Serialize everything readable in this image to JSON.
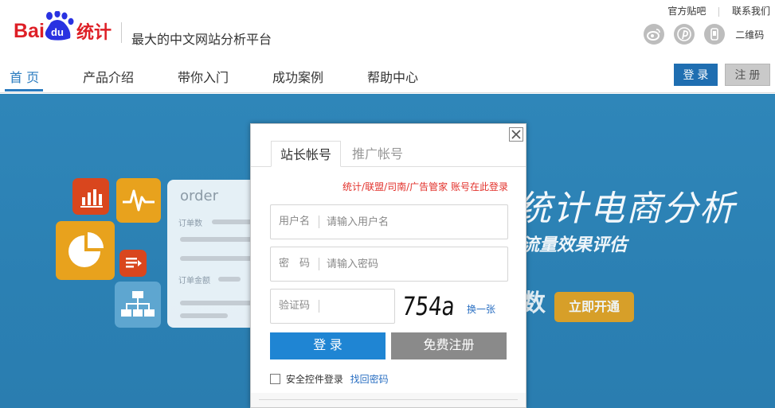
{
  "header": {
    "logo_text_bai": "Bai",
    "logo_text_du": "du",
    "logo_text_tongji": "统计",
    "tagline": "最大的中文网站分析平台",
    "top_links": [
      "官方贴吧",
      "联系我们"
    ],
    "qrcode_label": "二维码",
    "social_icons": [
      "weibo-icon",
      "pinterest-icon",
      "wechat-icon"
    ]
  },
  "nav": {
    "items": [
      "首 页",
      "产品介绍",
      "带你入门",
      "成功案例",
      "帮助中心"
    ],
    "active_index": 0,
    "login_label": "登 录",
    "register_label": "注 册"
  },
  "banner": {
    "card_title": "order",
    "card_labels": [
      "订单数",
      "订单金额"
    ],
    "title": "统计电商分析",
    "subtitle": "流量效果评估",
    "orange_text": "数",
    "cta_label": "立即开通"
  },
  "modal": {
    "tabs": [
      "站长帐号",
      "推广帐号"
    ],
    "active_tab": 0,
    "alt_login_text": "统计/联盟/司南/广告管家 账号在此登录",
    "username": {
      "label": "用户名",
      "placeholder": "请输入用户名",
      "value": ""
    },
    "password": {
      "label": "密　码",
      "placeholder": "请输入密码",
      "value": ""
    },
    "captcha": {
      "label": "验证码",
      "value": "",
      "image_text": "754a",
      "refresh_label": "换一张"
    },
    "login_button": "登 录",
    "register_button": "免费注册",
    "secure_login_label": "安全控件登录",
    "secure_login_checked": false,
    "forgot_password": "找回密码"
  },
  "colors": {
    "primary_blue": "#1f85d3",
    "nav_blue": "#2a7bbf",
    "baidu_red": "#de1f26",
    "baidu_blue": "#2932e1",
    "banner_blue": "#2f86b9",
    "link_red": "#e2312b",
    "link_blue": "#2a6fc2"
  }
}
